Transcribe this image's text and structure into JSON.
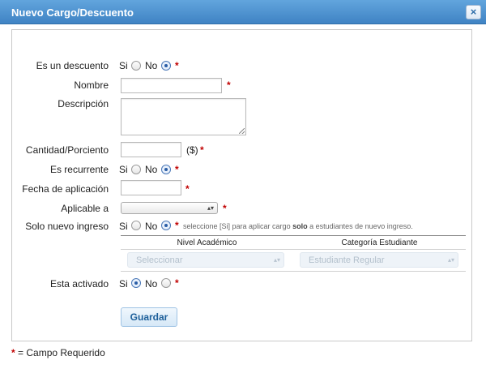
{
  "dialog": {
    "title": "Nuevo Cargo/Descuento",
    "close_icon": "close-icon"
  },
  "form": {
    "discount": {
      "label": "Es un descuento",
      "opt_yes": "Si",
      "opt_no": "No",
      "selected": "No"
    },
    "name": {
      "label": "Nombre",
      "value": ""
    },
    "description": {
      "label": "Descripción",
      "value": ""
    },
    "amount": {
      "label": "Cantidad/Porciento",
      "value": "",
      "unit": "($)"
    },
    "recurring": {
      "label": "Es recurrente",
      "opt_yes": "Si",
      "opt_no": "No",
      "selected": "No"
    },
    "apply_date": {
      "label": "Fecha de aplicación",
      "value": ""
    },
    "applies_to": {
      "label": "Aplicable a",
      "selected": ""
    },
    "new_only": {
      "label": "Solo nuevo ingreso",
      "opt_yes": "Si",
      "opt_no": "No",
      "selected": "No",
      "hint_pre": "seleccione [Si] para aplicar cargo",
      "hint_bold": "solo",
      "hint_post": "a estudiantes de nuevo ingreso."
    },
    "table": {
      "col_level": "Nivel Académico",
      "col_category": "Categoría Estudiante",
      "level_value": "Seleccionar",
      "category_value": "Estudiante Regular"
    },
    "active": {
      "label": "Esta activado",
      "opt_yes": "Si",
      "opt_no": "No",
      "selected": "Si"
    },
    "required_mark": "*",
    "save_label": "Guardar"
  },
  "footer": {
    "mark": "*",
    "text": "= Campo Requerido"
  },
  "colors": {
    "titlebar": "#4a8fd0",
    "required": "#c00000",
    "button_text": "#1d5f9a"
  }
}
